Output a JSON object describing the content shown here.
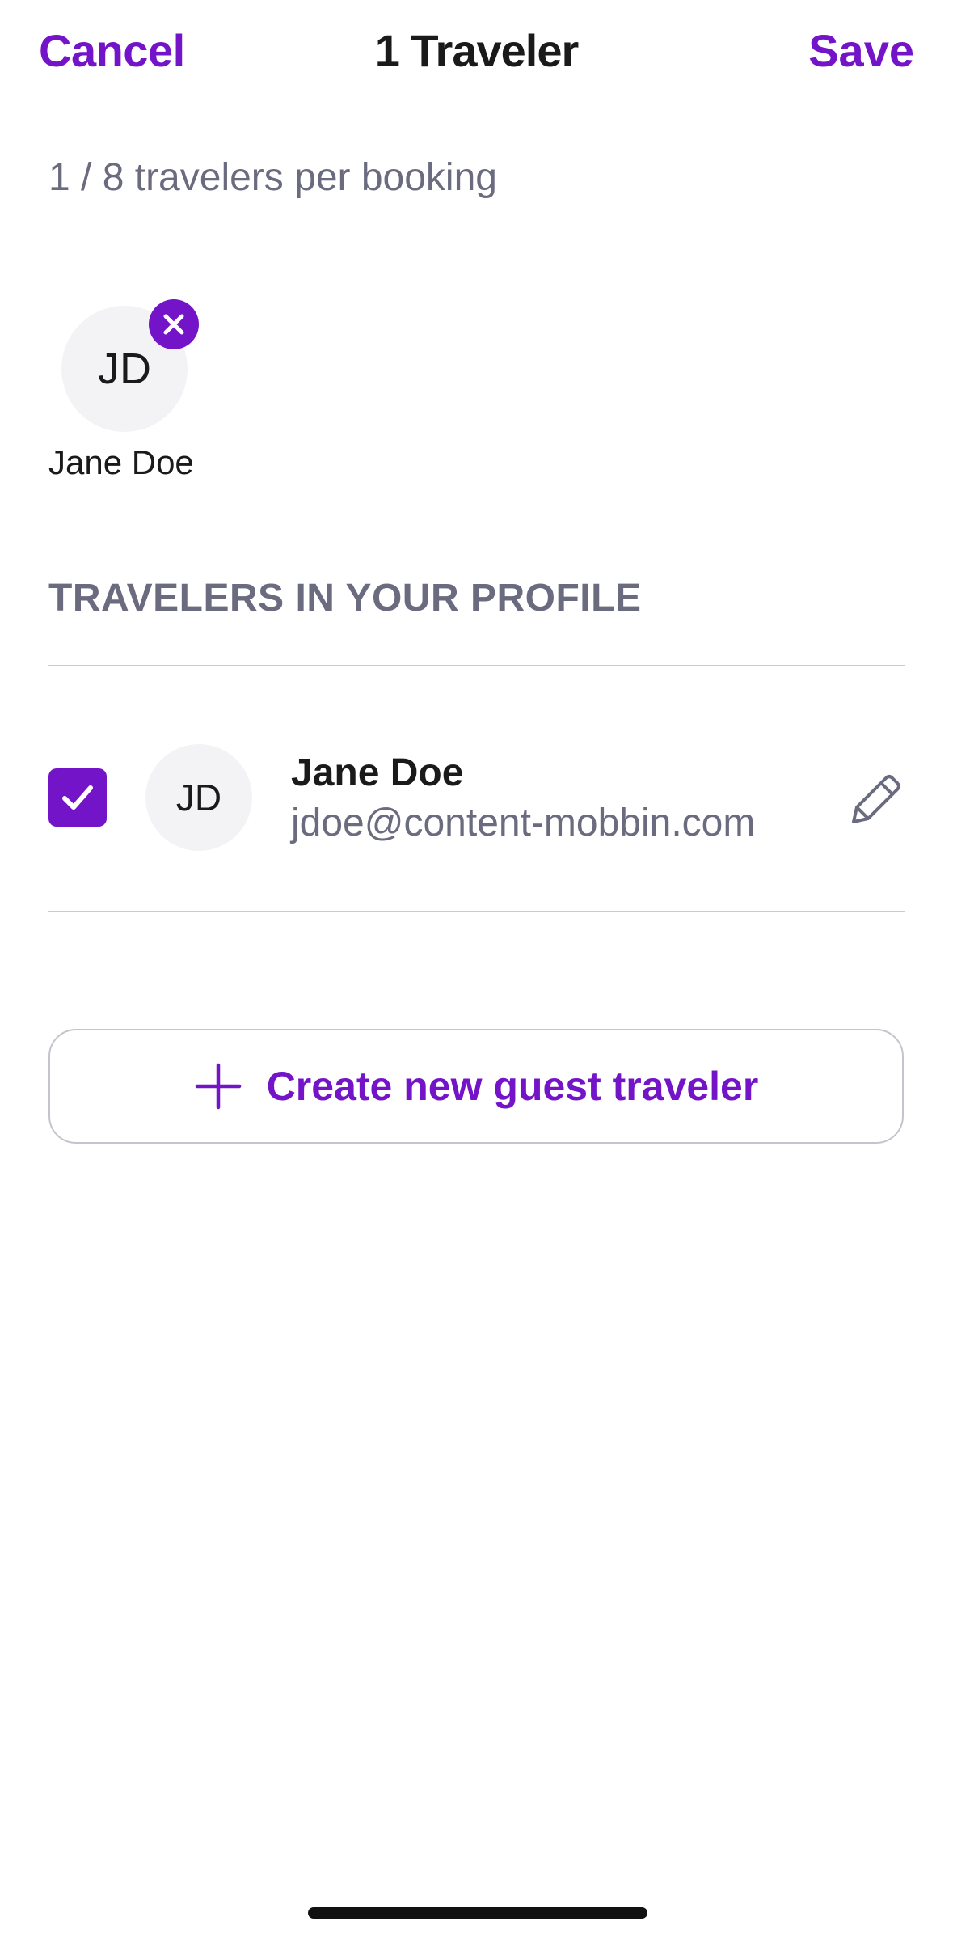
{
  "header": {
    "cancel_label": "Cancel",
    "title": "1 Traveler",
    "save_label": "Save"
  },
  "traveler_count": "1 / 8 travelers per booking",
  "selected_travelers": [
    {
      "initials": "JD",
      "name": "Jane Doe"
    }
  ],
  "profile_section": {
    "heading": "TRAVELERS IN YOUR PROFILE",
    "travelers": [
      {
        "initials": "JD",
        "name": "Jane Doe",
        "email": "jdoe@content-mobbin.com",
        "checked": true
      }
    ]
  },
  "create_button": {
    "label": "Create new guest traveler",
    "icon": "plus-icon"
  },
  "colors": {
    "accent": "#7414c8",
    "secondary_text": "#6b6b80",
    "avatar_bg": "#f3f3f6",
    "divider": "#c9c9d4"
  }
}
